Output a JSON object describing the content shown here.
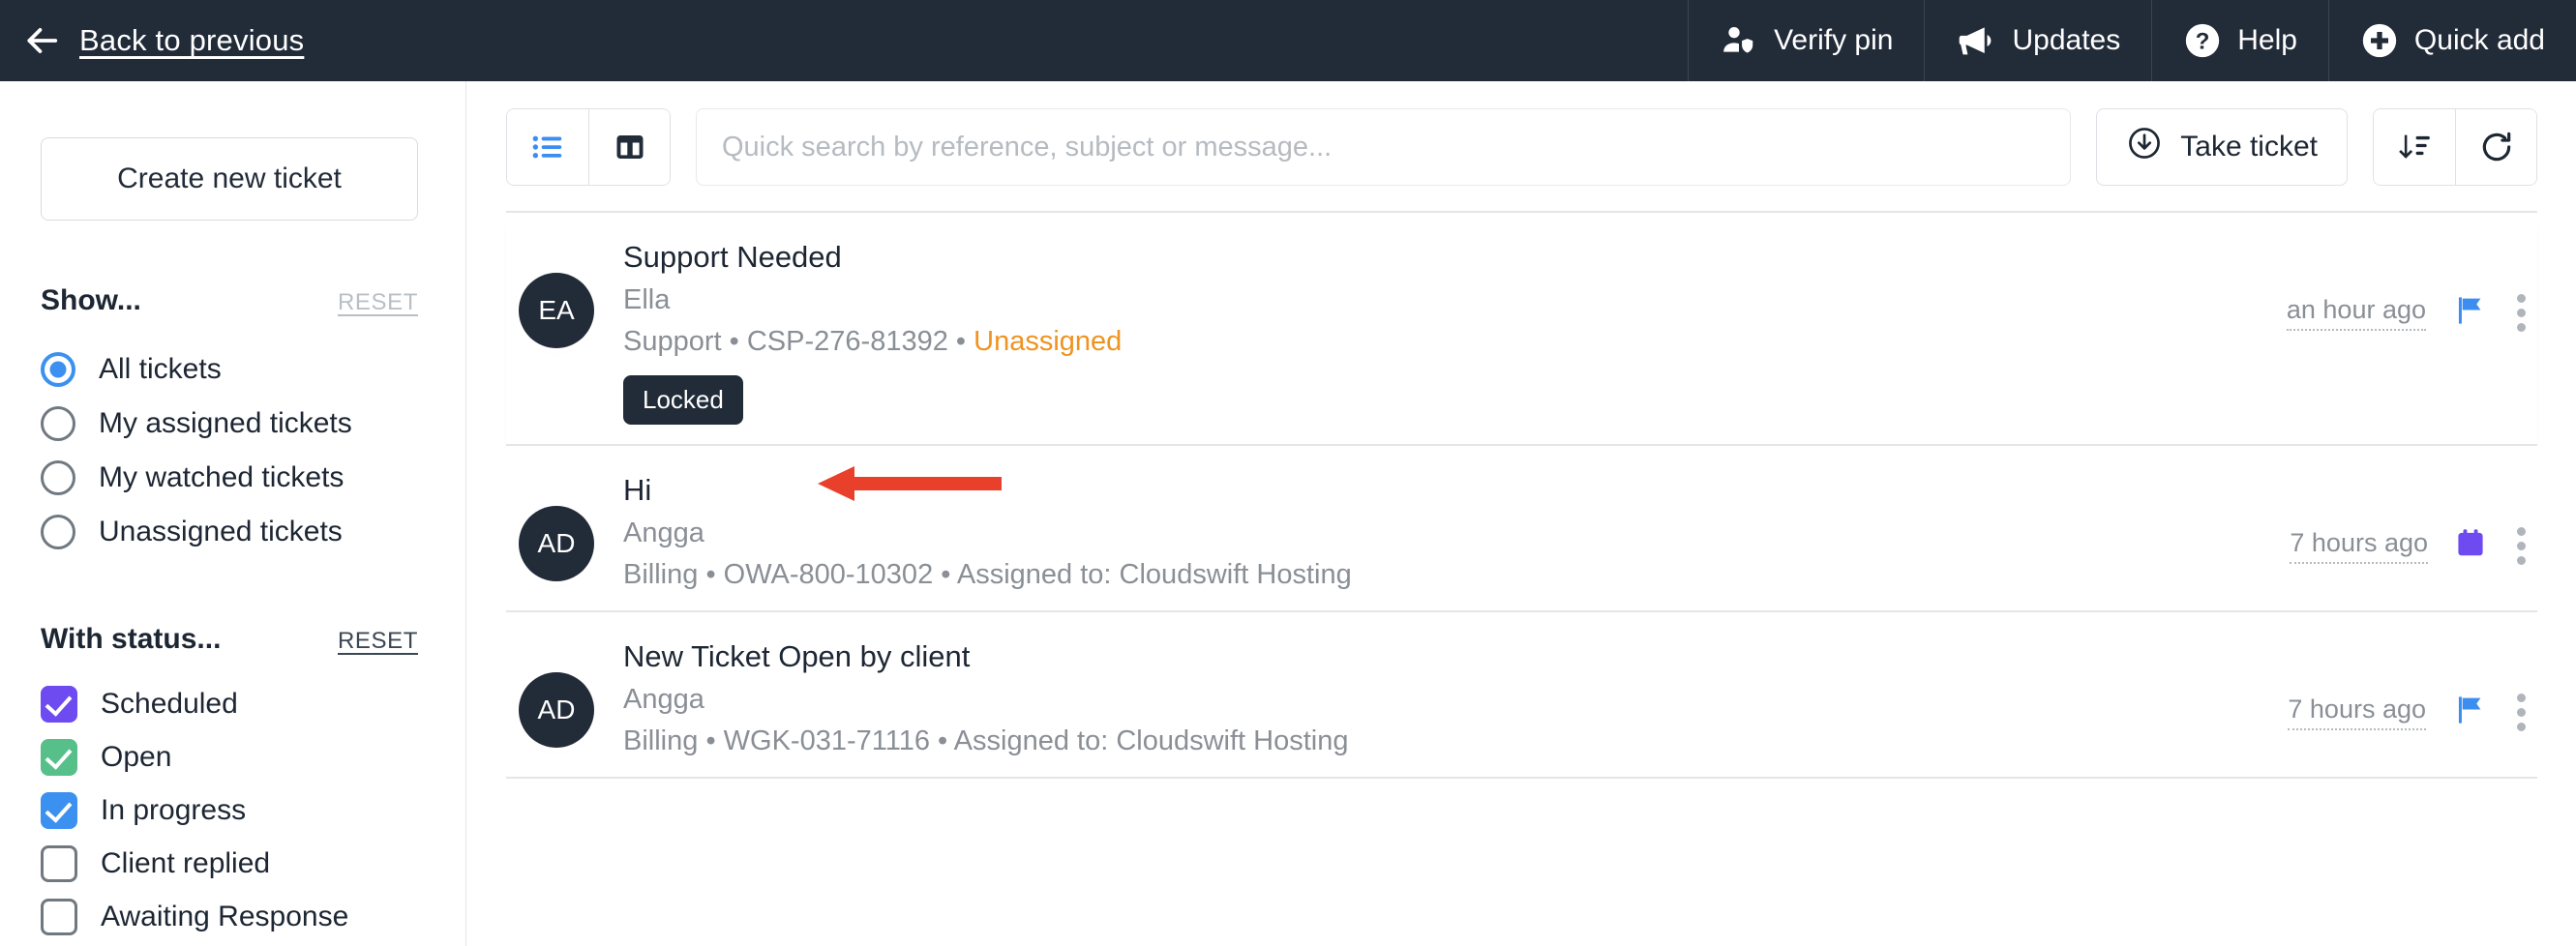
{
  "header": {
    "back_label": "Back to previous",
    "actions": [
      {
        "label": "Verify pin",
        "icon": "user-shield-icon"
      },
      {
        "label": "Updates",
        "icon": "megaphone-icon"
      },
      {
        "label": "Help",
        "icon": "question-circle-icon"
      },
      {
        "label": "Quick add",
        "icon": "plus-circle-icon"
      }
    ],
    "bg_color": "#222b38"
  },
  "sidebar": {
    "create_ticket_label": "Create new ticket",
    "show": {
      "title": "Show...",
      "reset_label": "RESET",
      "options": [
        {
          "label": "All tickets",
          "selected": true
        },
        {
          "label": "My assigned tickets",
          "selected": false
        },
        {
          "label": "My watched tickets",
          "selected": false
        },
        {
          "label": "Unassigned tickets",
          "selected": false
        }
      ]
    },
    "status": {
      "title": "With status...",
      "reset_label": "RESET",
      "options": [
        {
          "label": "Scheduled",
          "checked": true,
          "color": "#6d4bf0"
        },
        {
          "label": "Open",
          "checked": true,
          "color": "#57c08a"
        },
        {
          "label": "In progress",
          "checked": true,
          "color": "#3c91f0"
        },
        {
          "label": "Client replied",
          "checked": false,
          "color": "#ffffff"
        },
        {
          "label": "Awaiting Response",
          "checked": false,
          "color": "#ffffff"
        }
      ]
    }
  },
  "toolbar": {
    "list_view_icon": "list-view-icon",
    "board_view_icon": "board-view-icon",
    "active_view": "list",
    "search_placeholder": "Quick search by reference, subject or message...",
    "search_value": "",
    "take_ticket_label": "Take ticket",
    "sort_icon": "sort-descending-icon",
    "refresh_icon": "refresh-icon"
  },
  "tickets": [
    {
      "avatar_initials": "EA",
      "subject": "Support Needed",
      "client": "Ella",
      "department": "Support",
      "reference": "CSP-276-81392",
      "assignment": "Unassigned",
      "assignment_state": "unassigned",
      "meta_separator": "•",
      "badge": "Locked",
      "time": "an hour ago",
      "status_icon": "flag-icon",
      "status_color": "#3c91f0"
    },
    {
      "avatar_initials": "AD",
      "subject": "Hi",
      "client": "Angga",
      "department": "Billing",
      "reference": "OWA-800-10302",
      "assignment": "Assigned to: Cloudswift Hosting",
      "assignment_state": "assigned",
      "meta_separator": "•",
      "badge": "",
      "time": "7 hours ago",
      "status_icon": "calendar-icon",
      "status_color": "#6d4bf0"
    },
    {
      "avatar_initials": "AD",
      "subject": "New Ticket Open by client",
      "client": "Angga",
      "department": "Billing",
      "reference": "WGK-031-71116",
      "assignment": "Assigned to: Cloudswift Hosting",
      "assignment_state": "assigned",
      "meta_separator": "•",
      "badge": "",
      "time": "7 hours ago",
      "status_icon": "flag-icon",
      "status_color": "#3c91f0"
    }
  ],
  "annotation": {
    "type": "arrow",
    "color": "#e8402a",
    "points_to": "Locked"
  }
}
